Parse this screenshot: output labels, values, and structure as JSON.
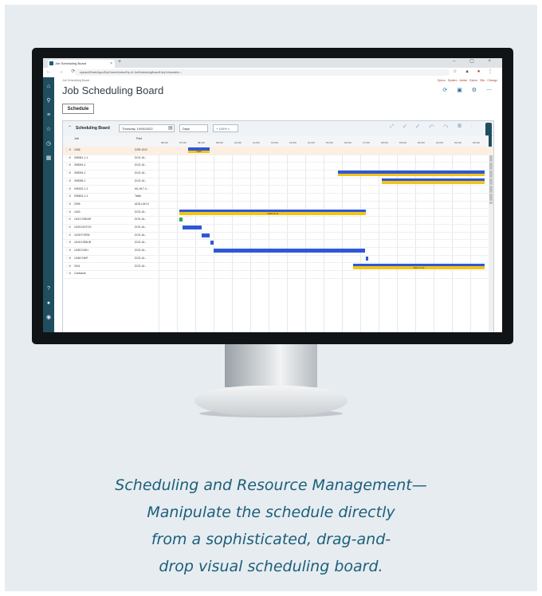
{
  "browser": {
    "tab_title": "Job Scheduling Board",
    "url": "epicaml/Einstr/Apps/Erp/Home/#/view/Erp.UI.JobSchedulingBoardEntry?channelid=..."
  },
  "app": {
    "breadcrumb": "Job Scheduling Board",
    "top_links": [
      "Epicor System Admin",
      "Epicor Site",
      "Chicago"
    ],
    "page_title": "Job Scheduling Board",
    "schedule_button": "Schedule",
    "board": {
      "title": "Scheduling Board",
      "date": "Thursday, 10/06/2022",
      "view": "Days",
      "zoom": "+ 100% ×",
      "col_job": "Job",
      "col_part": "Part"
    },
    "dates": [
      "06-Oct",
      "07-Oct",
      "08-Oct",
      "09-Oct",
      "10-Oct",
      "11-Oct",
      "12-Oct",
      "13-Oct",
      "14-Oct",
      "15-Oct",
      "16-Oct",
      "17-Oct",
      "18-Oct",
      "19-Oct",
      "20-Oct",
      "21-Oct",
      "22-Oct",
      "23-Oct"
    ],
    "rows": [
      {
        "job": "1046",
        "part": "DSR-1010",
        "selected": true
      },
      {
        "job": "005061-1-1",
        "part": "DCD-16..."
      },
      {
        "job": "005094-1",
        "part": "DCD-16..."
      },
      {
        "job": "005094-1",
        "part": "DCD-16..."
      },
      {
        "job": "005096-1",
        "part": "DCD-16..."
      },
      {
        "job": "005152-1-1",
        "part": "ML-HLT-4..."
      },
      {
        "job": "005604-1-1",
        "part": "Table"
      },
      {
        "job": "2006",
        "part": "ADD-LAH-0"
      },
      {
        "job": "1040",
        "part": "DCD-16..."
      },
      {
        "job": "10/10 SHEAR",
        "part": "DCD-16..."
      },
      {
        "job": "10/20 NOTCH",
        "part": "DCD-16..."
      },
      {
        "job": "10/30 FORM",
        "part": "DCD-16..."
      },
      {
        "job": "10/40 DEBUR",
        "part": "DCD-16..."
      },
      {
        "job": "10/50 DISH",
        "part": "DCD-16..."
      },
      {
        "job": "10/60 SHIP",
        "part": "DCD-16..."
      },
      {
        "job": "2041",
        "part": "DCD-16..."
      },
      {
        "job": "Contracts",
        "part": ""
      }
    ],
    "bar_labels": [
      "1046",
      "1040 (1-1)",
      "2041 (1-1)"
    ]
  },
  "caption": {
    "lines": [
      "Scheduling and Resource Management—",
      "Manipulate the schedule directly",
      "from a sophisticated, drag-and-",
      "drop visual scheduling board."
    ]
  },
  "colors": {
    "panel_bg": "#e7ecf0",
    "nav_bg": "#1f4e5f",
    "bar_blue": "#2f58d6",
    "bar_yellow": "#f2c418",
    "bar_green": "#2ca84a",
    "caption_text": "#1b5f7a"
  }
}
